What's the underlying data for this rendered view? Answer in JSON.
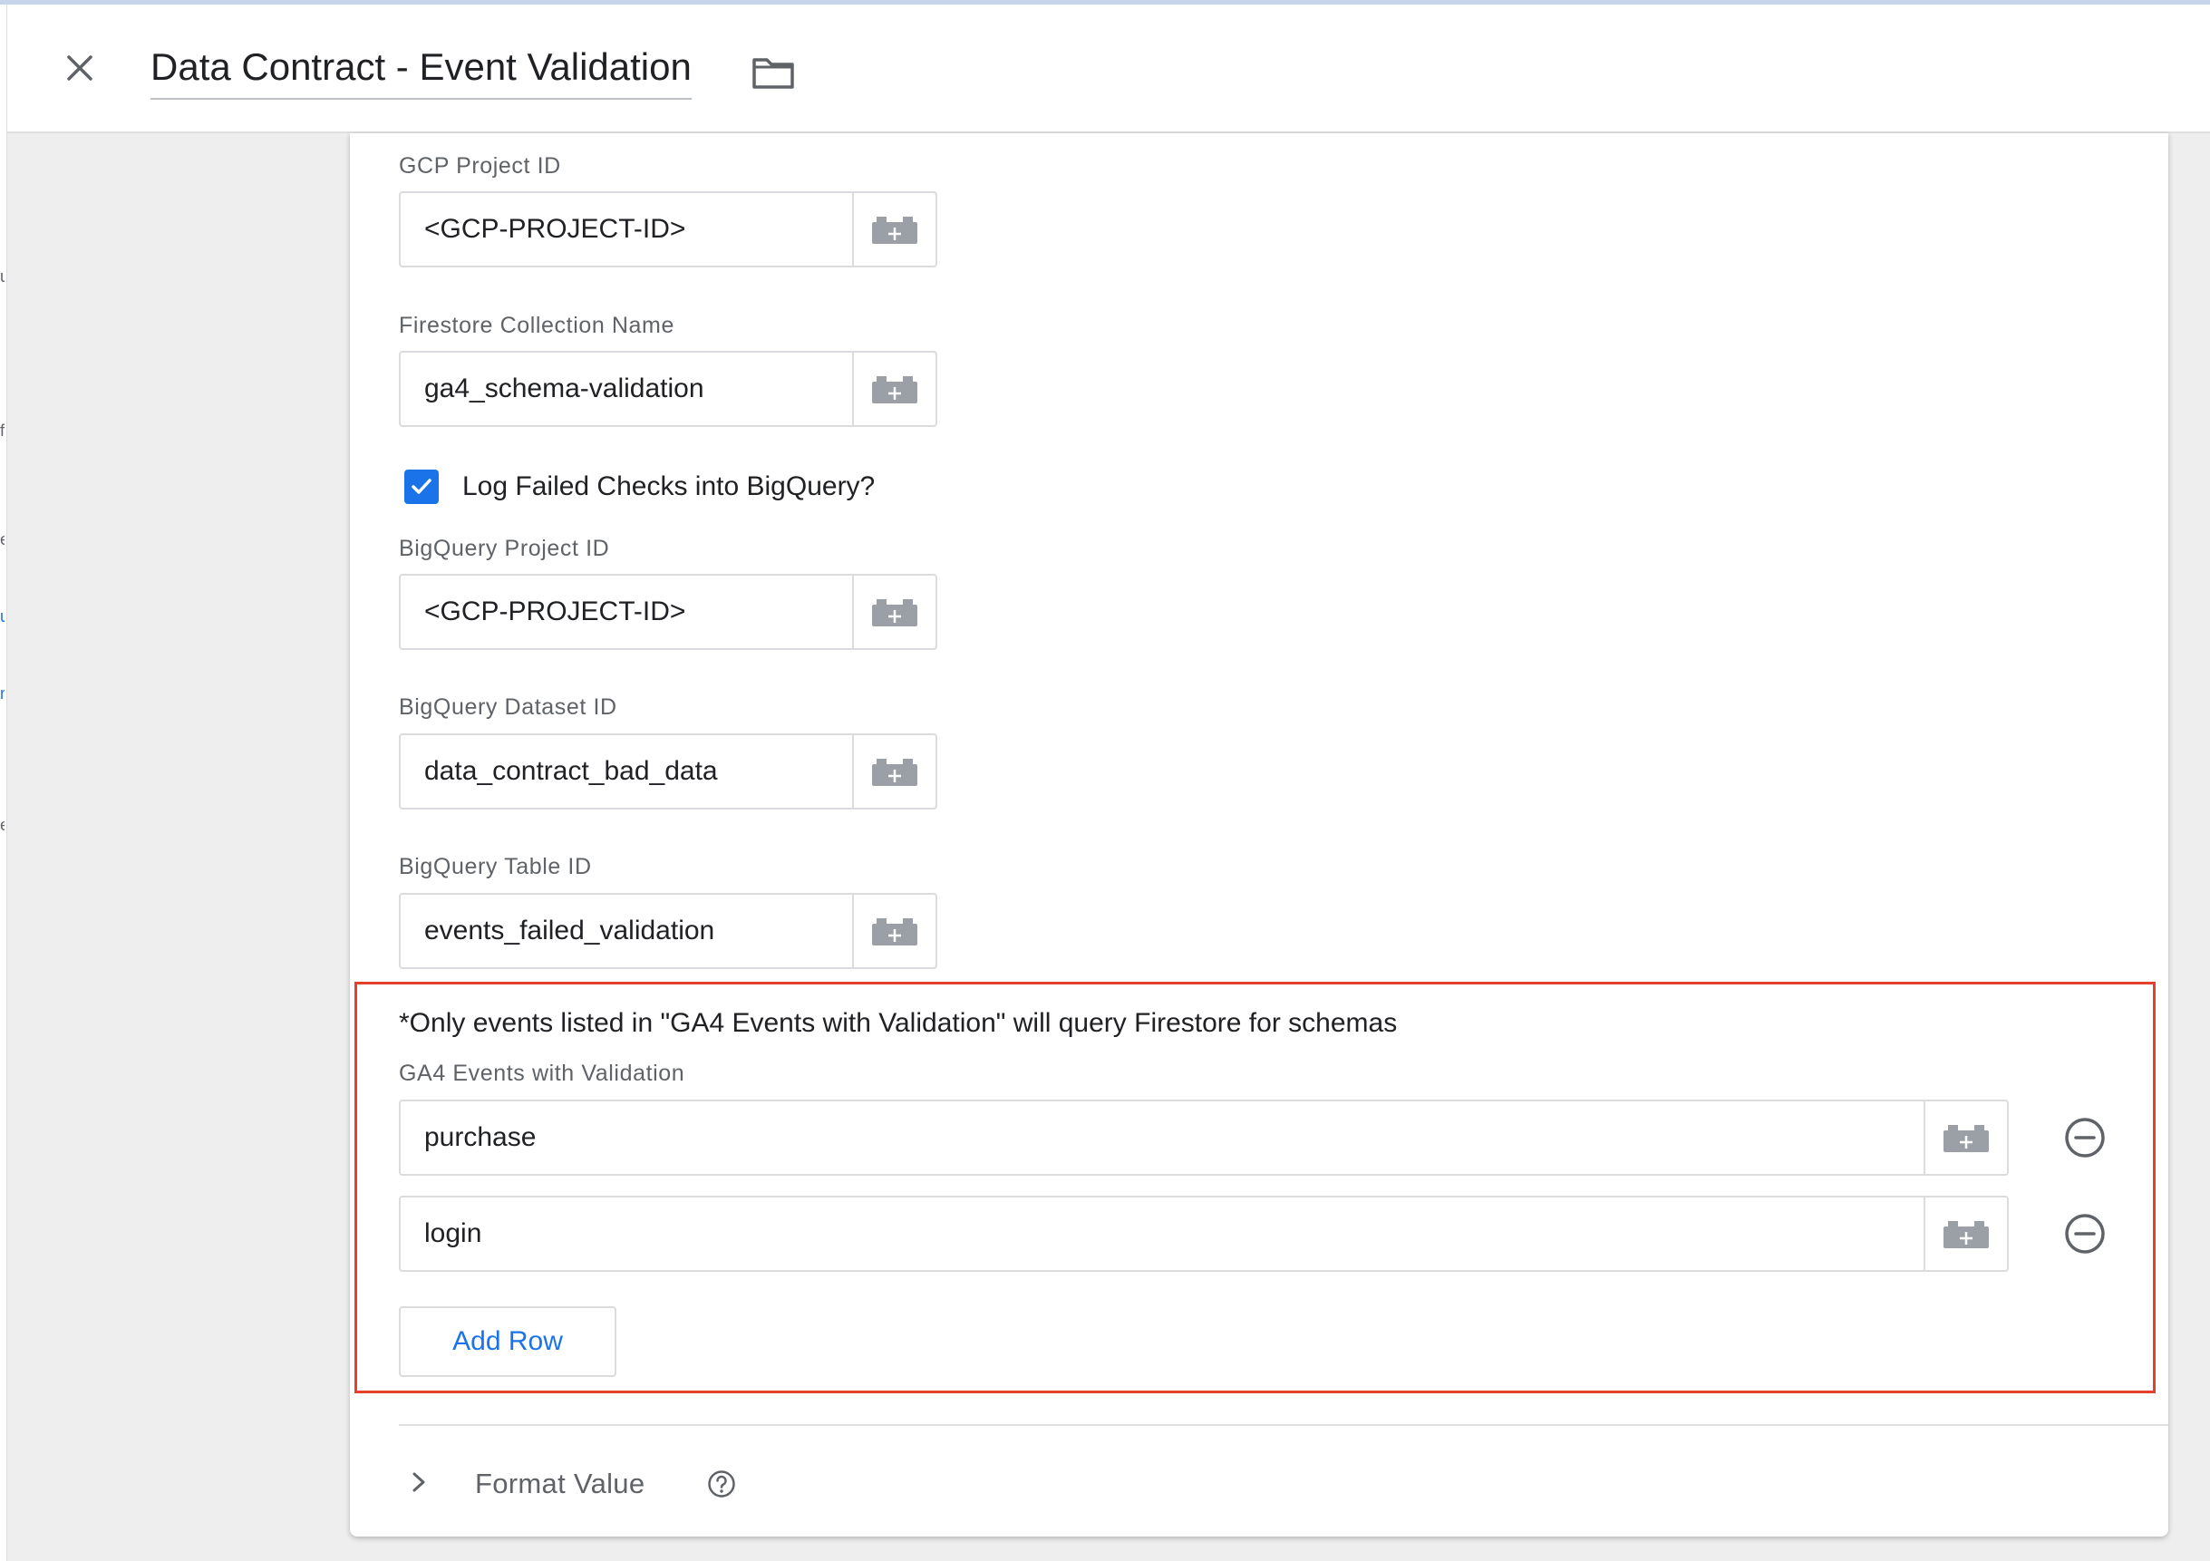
{
  "header": {
    "title": "Data Contract - Event Validation"
  },
  "fields": {
    "gcp_project_id": {
      "label": "GCP Project ID",
      "value": "<GCP-PROJECT-ID>"
    },
    "firestore_collection": {
      "label": "Firestore Collection Name",
      "value": "ga4_schema-validation"
    },
    "log_checkbox": {
      "label": "Log Failed Checks into BigQuery?",
      "checked": true
    },
    "bq_project_id": {
      "label": "BigQuery Project ID",
      "value": "<GCP-PROJECT-ID>"
    },
    "bq_dataset_id": {
      "label": "BigQuery Dataset ID",
      "value": "data_contract_bad_data"
    },
    "bq_table_id": {
      "label": "BigQuery Table ID",
      "value": "events_failed_validation"
    }
  },
  "validation": {
    "note": "*Only events listed in \"GA4 Events with Validation\" will query Firestore for schemas",
    "label": "GA4 Events with Validation",
    "rows": [
      "purchase",
      "login"
    ],
    "add_row_label": "Add Row"
  },
  "format_value": {
    "label": "Format Value"
  },
  "colors": {
    "accent": "#1a73e8",
    "highlight": "#e5402b"
  },
  "icons": {
    "close": "close-icon",
    "folder": "folder-icon",
    "variable": "variable-brick-icon",
    "remove": "minus-circle-icon",
    "chevron": "chevron-right-icon",
    "help": "help-icon"
  }
}
